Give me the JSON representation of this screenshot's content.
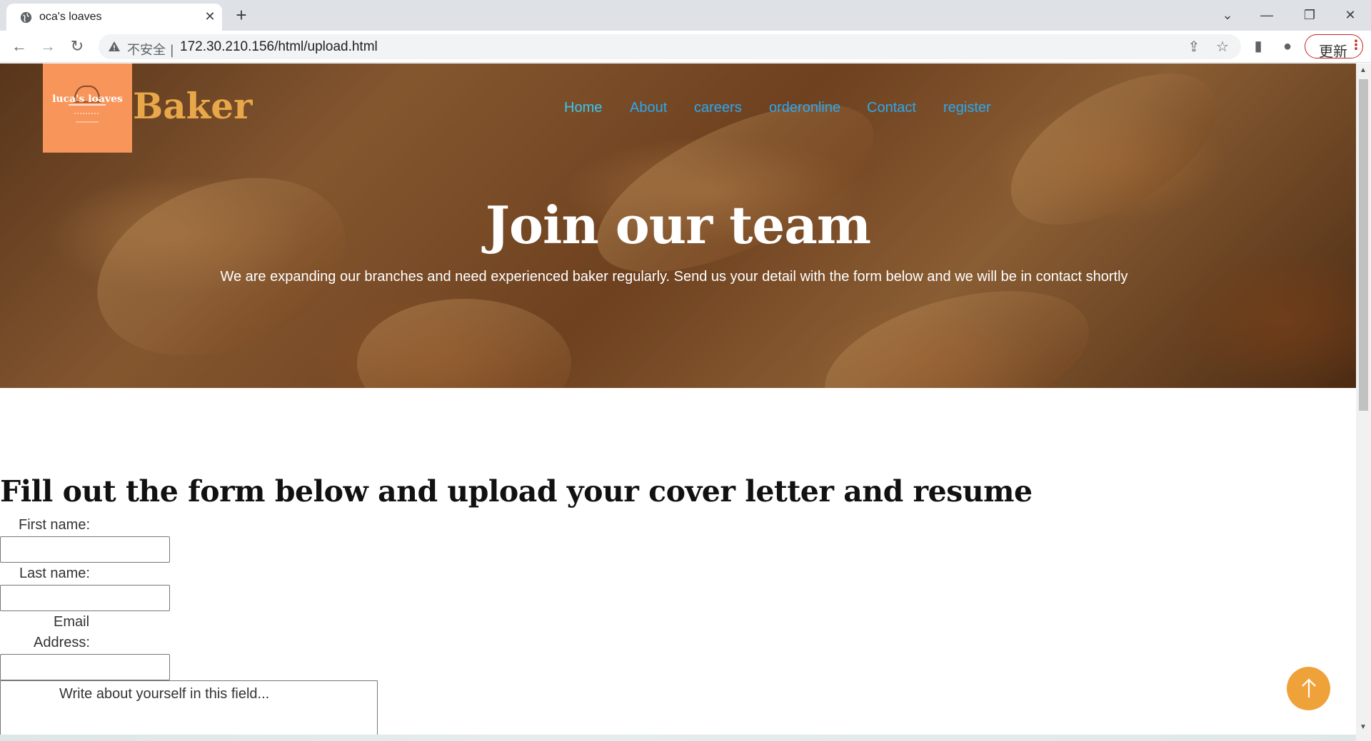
{
  "browser": {
    "tab_title": "oca's loaves",
    "insecure_label": "不安全 |",
    "url": "172.30.210.156/html/upload.html",
    "update_label": "更新",
    "accent": "#c5221f"
  },
  "site": {
    "logo_text": "luca's loaves",
    "brand": "Baker",
    "brand_color": "#e8a84a",
    "logo_bg": "#f8955a",
    "nav": [
      {
        "label": "Home"
      },
      {
        "label": "About"
      },
      {
        "label": "careers"
      },
      {
        "label": "orderonline"
      },
      {
        "label": "Contact"
      },
      {
        "label": "register"
      }
    ],
    "nav_color": "#2aa8f2"
  },
  "hero": {
    "title": "Join our team",
    "subtitle": "We are expanding our branches and need experienced baker regularly. Send us your detail with the form below and we will be in contact shortly"
  },
  "form": {
    "heading": "Fill out the form below and upload your cover letter and resume",
    "first_name_label": "First name:",
    "last_name_label": "Last name:",
    "email_label_1": "Email",
    "email_label_2": "Address:",
    "first_name_value": "",
    "last_name_value": "",
    "email_value": "",
    "about_placeholder": "Write about yourself in this field..."
  },
  "icons": {
    "back_to_top": "arrow-up-icon",
    "back_to_top_color": "#f0a23a"
  }
}
